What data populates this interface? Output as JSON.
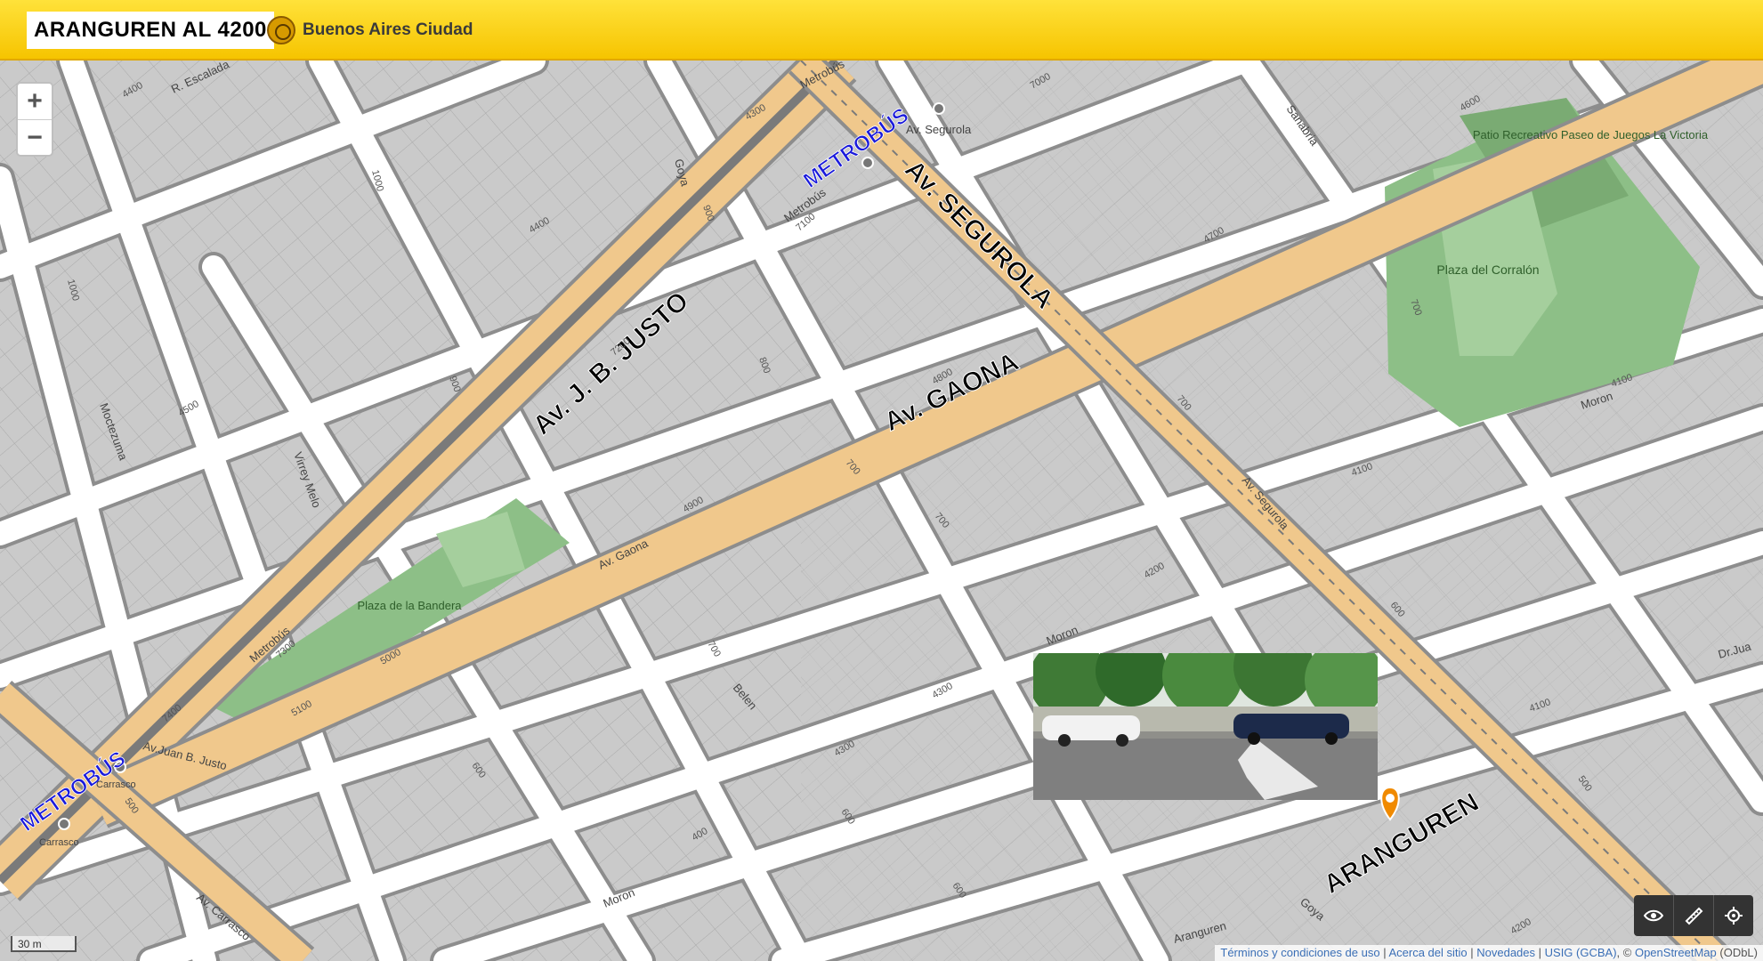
{
  "header": {
    "title": "ARANGUREN AL 4200",
    "brand_text": "Buenos Aires Ciudad"
  },
  "map": {
    "labels": {
      "metrobus_1": "METROBÚS",
      "metrobus_2": "METROBÚS",
      "jb_justo": "Av. J. B. JUSTO",
      "segurola_big": "Av. SEGUROLA",
      "gaona_big": "Av. GAONA",
      "aranguren_big": "ARANGUREN",
      "r_escalada": "R. Escalada",
      "av_segurola_small": "Av. Segurola",
      "av_segurola_small2": "Av. Segurola",
      "av_gaona_small": "Av. Gaona",
      "av_juan_b_justo": "Av.Juan B. Justo",
      "metrobus_small1": "Metrobús",
      "metrobus_small2": "Metrobús",
      "metrobus_small3": "Metrobús",
      "goya1": "Goya",
      "goya2": "Goya",
      "sanabria": "Sanabria",
      "moctezuma": "Moctezuma",
      "virrey_melo": "Virrey Melo",
      "belen": "Belen",
      "moron1": "Moron",
      "moron2": "Moron",
      "moron3": "Moron",
      "carrasco1": "Carrasco",
      "carrasco2": "Carrasco",
      "av_carrasco": "Av. Carrasco",
      "dr_jua": "Dr.Jua",
      "aranguren_small": "Aranguren",
      "park1": "Plaza del Corralón",
      "park2": "Patio Recreativo Paseo de Juegos La Victoria",
      "park3": "Plaza de la Bandera",
      "n4400": "4400",
      "n7000": "7000",
      "n4300": "4300",
      "n4400b": "4400",
      "n4600": "4600",
      "n7100": "7100",
      "n1000": "1000",
      "n1000b": "1000",
      "n900": "900",
      "n900b": "900",
      "n800": "800",
      "n700": "700",
      "n700b": "700",
      "n700c": "700",
      "n700d": "700",
      "n700e": "700",
      "n4700": "4700",
      "n4800": "4800",
      "n4900": "4900",
      "n7200": "7200",
      "n4500": "4500",
      "n5000": "5000",
      "n5100": "5100",
      "n7300": "7300",
      "n7400": "7400",
      "n4100": "4100",
      "n4100b": "4100",
      "n4100c": "4100",
      "n4200": "4200",
      "n4200b": "4200",
      "n4300b": "4300",
      "n4300c": "4300",
      "n600": "600",
      "n600b": "600",
      "n600c": "600",
      "n600d": "600",
      "n500": "500",
      "n500b": "500",
      "n400": "400"
    }
  },
  "controls": {
    "zoom_in": "+",
    "zoom_out": "−",
    "scale": "30 m"
  },
  "footer": {
    "terms": "Términos y condiciones de uso",
    "about": "Acerca del sitio",
    "news": "Novedades",
    "usig": "USIG (GCBA)",
    "osm": "OpenStreetMap",
    "odbl": "(ODbL)",
    "sep": " | ",
    "copy": ", © "
  },
  "colors": {
    "header": "#f6c400",
    "avenue": "#f0c88c",
    "street": "#ffffff",
    "block": "#c9c9c9",
    "park": "#8dbf87",
    "metrobus_label": "#1a1adb",
    "marker": "#f08a00"
  }
}
